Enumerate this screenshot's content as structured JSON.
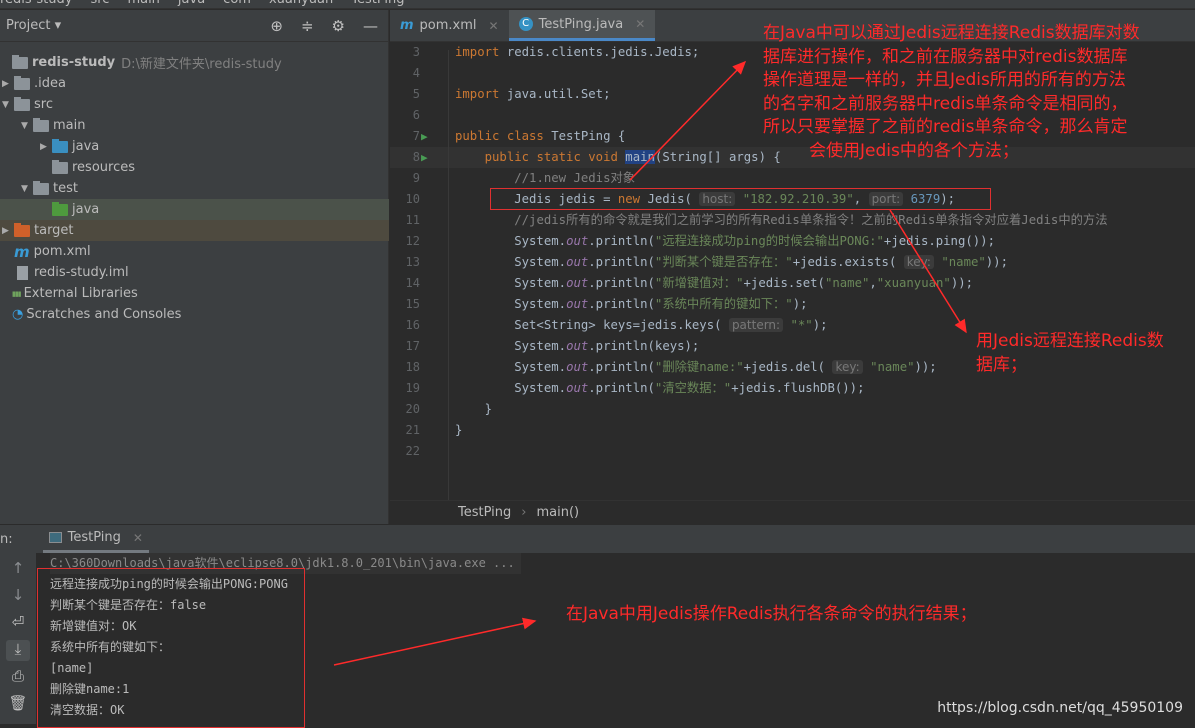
{
  "navbar": {
    "crumbs": [
      "redis-study",
      "src",
      "main",
      "java",
      "com",
      "xuanyuan",
      "TestPing"
    ]
  },
  "project": {
    "title": "Project",
    "tools": [
      "crosshair-icon",
      "collapse-icon",
      "gear-icon",
      "minimize-icon"
    ],
    "tree": [
      {
        "label": "redis-study",
        "hint": "D:\\新建文件夹\\redis-study",
        "depth": 0,
        "arrow": "",
        "icon": "module",
        "bold": true
      },
      {
        "label": ".idea",
        "depth": 1,
        "arrow": "▶",
        "icon": "folder"
      },
      {
        "label": "src",
        "depth": 1,
        "arrow": "▼",
        "icon": "folder"
      },
      {
        "label": "main",
        "depth": 2,
        "arrow": "▼",
        "icon": "folder"
      },
      {
        "label": "java",
        "depth": 3,
        "arrow": "▶",
        "icon": "folder-source"
      },
      {
        "label": "resources",
        "depth": 3,
        "arrow": "",
        "icon": "folder-resources"
      },
      {
        "label": "test",
        "depth": 2,
        "arrow": "▼",
        "icon": "folder"
      },
      {
        "label": "java",
        "depth": 3,
        "arrow": "",
        "icon": "folder-test",
        "selected": true
      },
      {
        "label": "target",
        "depth": 1,
        "arrow": "▶",
        "icon": "folder-excluded",
        "excluded": true
      },
      {
        "label": "pom.xml",
        "depth": 1,
        "arrow": "",
        "icon": "maven"
      },
      {
        "label": "redis-study.iml",
        "depth": 1,
        "arrow": "",
        "icon": "iml-file"
      },
      {
        "label": "External Libraries",
        "depth": 0,
        "arrow": "",
        "icon": "libraries"
      },
      {
        "label": "Scratches and Consoles",
        "depth": 0,
        "arrow": "",
        "icon": "scratches"
      }
    ]
  },
  "editor": {
    "tabs": [
      {
        "label": "pom.xml",
        "icon": "maven-icon"
      },
      {
        "label": "TestPing.java",
        "icon": "java-class-icon",
        "active": true
      }
    ],
    "lines": [
      {
        "n": 3,
        "html": "<span class='kw'>import</span> redis.clients.jedis.Jedis;"
      },
      {
        "n": 4,
        "html": ""
      },
      {
        "n": 5,
        "html": "<span class='kw'>import</span> java.util.Set;"
      },
      {
        "n": 6,
        "html": ""
      },
      {
        "n": 7,
        "html": "<span class='kw'>public class</span> TestPing {",
        "run": true
      },
      {
        "n": 8,
        "html": "    <span class='kw'>public static void</span> <span style='background:#214283'>main</span>(String[] args) {",
        "run": true
      },
      {
        "n": 9,
        "html": "        <span class='cm'>//1.new Jedis对象</span>"
      },
      {
        "n": 10,
        "html": "        Jedis jedis = <span class='kw'>new</span> Jedis( <span class='param'>host:</span> <span class='str'>\"182.92.210.39\"</span>, <span class='param'>port:</span> <span class='num'>6379</span>);"
      },
      {
        "n": 11,
        "html": "        <span class='cm'>//jedis所有的命令就是我们之前学习的所有Redis单条指令！之前的Redis单条指令对应着Jedis中的方法</span>"
      },
      {
        "n": 12,
        "html": "        System.<span class='out'>out</span>.println(<span class='str'>\"远程连接成功ping的时候会输出PONG:\"</span>+jedis.ping());"
      },
      {
        "n": 13,
        "html": "        System.<span class='out'>out</span>.println(<span class='str'>\"判断某个键是否存在：\"</span>+jedis.exists( <span class='param'>key:</span> <span class='str'>\"name\"</span>));"
      },
      {
        "n": 14,
        "html": "        System.<span class='out'>out</span>.println(<span class='str'>\"新增键值对：\"</span>+jedis.set(<span class='str'>\"name\"</span>,<span class='str'>\"xuanyuan\"</span>));"
      },
      {
        "n": 15,
        "html": "        System.<span class='out'>out</span>.println(<span class='str'>\"系统中所有的键如下：\"</span>);"
      },
      {
        "n": 16,
        "html": "        Set&lt;String&gt; keys=jedis.keys( <span class='param'>pattern:</span> <span class='str'>\"*\"</span>);"
      },
      {
        "n": 17,
        "html": "        System.<span class='out'>out</span>.println(keys);"
      },
      {
        "n": 18,
        "html": "        System.<span class='out'>out</span>.println(<span class='str'>\"删除键name:\"</span>+jedis.del( <span class='param'>key:</span> <span class='str'>\"name\"</span>));"
      },
      {
        "n": 19,
        "html": "        System.<span class='out'>out</span>.println(<span class='str'>\"清空数据：\"</span>+jedis.flushDB());"
      },
      {
        "n": 20,
        "html": "    }"
      },
      {
        "n": 21,
        "html": "}"
      },
      {
        "n": 22,
        "html": ""
      }
    ],
    "breadcrumb": [
      "TestPing",
      "main()"
    ]
  },
  "run": {
    "label": "n:",
    "tab": "TestPing",
    "command": "C:\\360Downloads\\java软件\\eclipse8.0\\jdk1.8.0_201\\bin\\java.exe ...",
    "output": [
      "远程连接成功ping的时候会输出PONG:PONG",
      "判断某个键是否存在：false",
      "新增键值对：OK",
      "系统中所有的键如下：",
      "[name]",
      "删除键name:1",
      "清空数据：OK"
    ],
    "toolbar": [
      "arrow-up-icon",
      "arrow-down-icon",
      "soft-wrap-icon",
      "scroll-to-end-icon",
      "print-icon",
      "trash-icon"
    ]
  },
  "annotations": {
    "top": [
      "在Java中可以通过Jedis远程连接Redis数据库对数",
      "据库进行操作，和之前在服务器中对redis数据库",
      "操作道理是一样的，并且Jedis所用的所有的方法",
      "的名字和之前服务器中redis单条命令是相同的，",
      "所以只要掌握了之前的redis单条命令，那么肯定",
      "会使用Jedis中的各个方法；"
    ],
    "middle": [
      "用Jedis远程连接Redis数",
      "据库；"
    ],
    "bottom": "在Java中用Jedis操作Redis执行各条命令的执行结果；",
    "color": "#ff2a2a"
  },
  "watermark": "https://blog.csdn.net/qq_45950109"
}
